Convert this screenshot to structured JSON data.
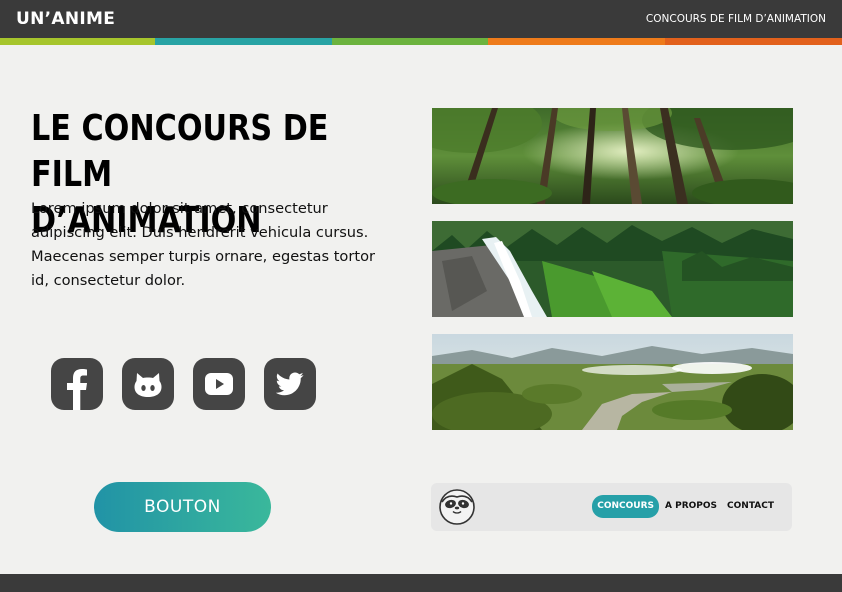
{
  "header": {
    "logo": "UN’ANIME",
    "tagline": "CONCOURS DE FILM D’ANIMATION"
  },
  "stripe_colors": [
    "#a6c52c",
    "#28a3a4",
    "#6cb33e",
    "#ee7b1b",
    "#e2611c"
  ],
  "hero": {
    "title": "LE CONCOURS DE FILM D’ANIMATION",
    "text": "Lorem ipsum dolor sit amet, consectetur adipiscing elit. Duis hendrerit vehicula cursus. Maecenas semper turpis ornare, egestas tortor id, consectetur dolor."
  },
  "socials": [
    {
      "icon": "facebook-icon"
    },
    {
      "icon": "github-icon"
    },
    {
      "icon": "youtube-icon"
    },
    {
      "icon": "twitter-icon"
    }
  ],
  "cta": {
    "label": "BOUTON"
  },
  "gallery": [
    {
      "subject": "forest canopy"
    },
    {
      "subject": "waterfall in forest"
    },
    {
      "subject": "river valley landscape"
    }
  ],
  "navbar": {
    "mascot_icon": "sloth-icon",
    "items": [
      {
        "label": "CONCOURS",
        "active": true
      },
      {
        "label": "A PROPOS",
        "active": false
      },
      {
        "label": "CONTACT",
        "active": false
      }
    ],
    "active_color": "#26a0a8"
  }
}
